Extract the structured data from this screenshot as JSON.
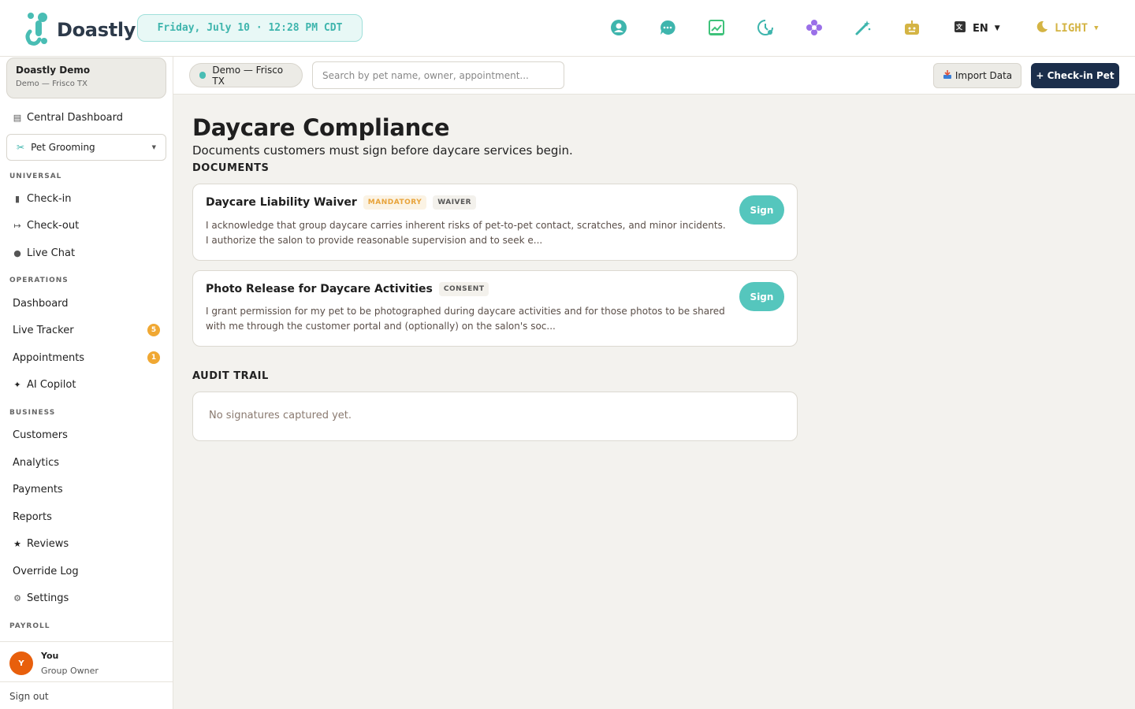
{
  "app": {
    "name": "Doastly",
    "datetime": "Friday, July 10 · 12:28 PM CDT",
    "language": "EN",
    "theme": "LIGHT"
  },
  "topbar_icons": [
    {
      "name": "support-icon",
      "color": "#3eb5ad"
    },
    {
      "name": "chat-bubble-icon",
      "color": "#3eb5ad"
    },
    {
      "name": "chart-icon",
      "color": "#3ec27a"
    },
    {
      "name": "history-clock-icon",
      "color": "#3eb5ad"
    },
    {
      "name": "flower-icon",
      "color": "#9a6fe8"
    },
    {
      "name": "magic-wand-icon",
      "color": "#3eb5ad"
    },
    {
      "name": "robot-icon",
      "color": "#d4b444"
    }
  ],
  "sidebar": {
    "org_name": "Doastly Demo",
    "org_location": "Demo — Frisco TX",
    "central_dashboard": "Central Dashboard",
    "module": "Pet Grooming",
    "sections": {
      "universal": "UNIVERSAL",
      "operations": "OPERATIONS",
      "business": "BUSINESS",
      "payroll": "PAYROLL"
    },
    "items": {
      "checkin": "Check-in",
      "checkout": "Check-out",
      "live_chat": "Live Chat",
      "dashboard": "Dashboard",
      "live_tracker": "Live Tracker",
      "live_tracker_badge": "5",
      "appointments": "Appointments",
      "appointments_badge": "1",
      "ai_copilot": "AI Copilot",
      "customers": "Customers",
      "analytics": "Analytics",
      "payments": "Payments",
      "reports": "Reports",
      "reviews": "Reviews",
      "override_log": "Override Log",
      "settings": "Settings"
    },
    "user": {
      "initial": "Y",
      "name": "You",
      "role": "Group Owner"
    },
    "sign_out": "Sign out"
  },
  "subbar": {
    "location": "Demo — Frisco TX",
    "search_placeholder": "Search by pet name, owner, appointment...",
    "import_label": "Import Data",
    "checkin_label": "+ Check-in Pet"
  },
  "main": {
    "title": "Daycare Compliance",
    "subtitle": "Documents customers must sign before daycare services begin.",
    "documents_heading": "DOCUMENTS",
    "documents": [
      {
        "title": "Daycare Liability Waiver",
        "mandatory": "MANDATORY",
        "type": "WAIVER",
        "text": "I acknowledge that group daycare carries inherent risks of pet-to-pet contact, scratches, and minor incidents. I authorize the salon to provide reasonable supervision and to seek e...",
        "action": "Sign"
      },
      {
        "title": "Photo Release for Daycare Activities",
        "type": "CONSENT",
        "text": "I grant permission for my pet to be photographed during daycare activities and for those photos to be shared with me through the customer portal and (optionally) on the salon's soc...",
        "action": "Sign"
      }
    ],
    "audit_heading": "AUDIT TRAIL",
    "audit_empty": "No signatures captured yet."
  }
}
